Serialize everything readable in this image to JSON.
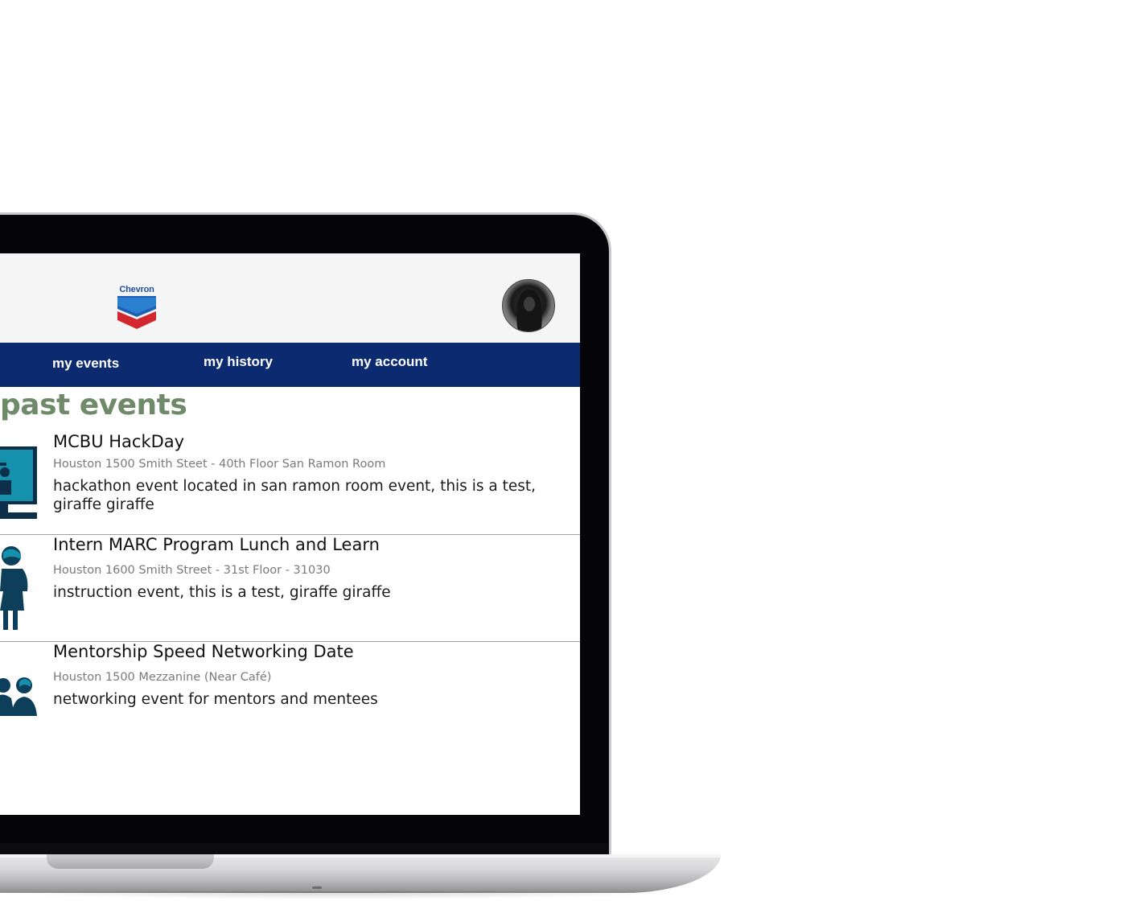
{
  "brand": {
    "name": "Chevron"
  },
  "nav": {
    "items": [
      {
        "label": "my events"
      },
      {
        "label": "my history"
      },
      {
        "label": "my account"
      }
    ]
  },
  "page": {
    "title": "past events"
  },
  "events": [
    {
      "title": "MCBU HackDay",
      "location": "Houston 1500 Smith Steet - 40th Floor San Ramon Room",
      "description": "hackathon event located in san ramon room event, this is a test, giraffe giraffe",
      "icon": "presenter-monitor-icon"
    },
    {
      "title": "Intern MARC Program Lunch and Learn",
      "location": "Houston 1600 Smith Street - 31st Floor - 31030",
      "description": "instruction event, this is a test, giraffe giraffe",
      "icon": "person-standing-icon"
    },
    {
      "title": "Mentorship Speed Networking Date",
      "location": "Houston 1500 Mezzanine (Near Café)",
      "description": "networking event for mentors and mentees",
      "icon": "two-people-icon"
    }
  ],
  "colors": {
    "nav_bg": "#0b2a6f",
    "title_green": "#6f8a68",
    "icon_teal": "#0e7a93",
    "icon_navy": "#0d3f5a"
  }
}
